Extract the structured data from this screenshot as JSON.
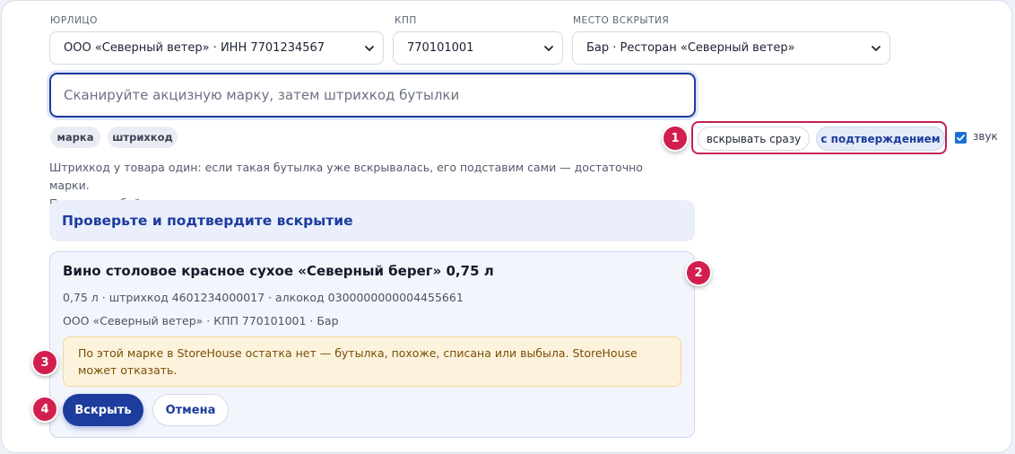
{
  "filters": {
    "legal_entity": {
      "label": "ЮРЛИЦО",
      "value": "ООО «Северный ветер» · ИНН 7701234567"
    },
    "kpp": {
      "label": "КПП",
      "value": "770101001"
    },
    "location": {
      "label": "МЕСТО ВСКРЫТИЯ",
      "value": "Бар · Ресторан «Северный ветер»"
    }
  },
  "scan": {
    "placeholder": "Сканируйте акцизную марку, затем штрихкод бутылки"
  },
  "chips": [
    "марка",
    "штрихкод"
  ],
  "hint": {
    "line1": "Штрихкод у товара один: если такая бутылка уже вскрывалась, его подставим сами — достаточно марки.",
    "line2": "Порядок любой."
  },
  "mode": {
    "immediate": "вскрывать сразу",
    "confirm": "с подтверждением",
    "active": "confirm"
  },
  "sound": {
    "label": "звук",
    "checked": true
  },
  "notice": "Проверьте и подтвердите вскрытие",
  "item": {
    "title": "Вино столовое красное сухое «Северный берег» 0,75 л",
    "details": "0,75 л · штрихкод 4601234000017 · алкокод 0300000000004455661",
    "owner": "ООО «Северный ветер» · КПП 770101001 · Бар",
    "warning": "По этой марке в StoreHouse остатка нет — бутылка, похоже, списана или выбыла. StoreHouse может отказать."
  },
  "actions": {
    "open": "Вскрыть",
    "cancel": "Отмена"
  },
  "badges": [
    "1",
    "2",
    "3",
    "4"
  ],
  "colors": {
    "accent": "#1d3c9e",
    "badge": "#d21f4f",
    "warning_bg": "#fdf3dc"
  }
}
